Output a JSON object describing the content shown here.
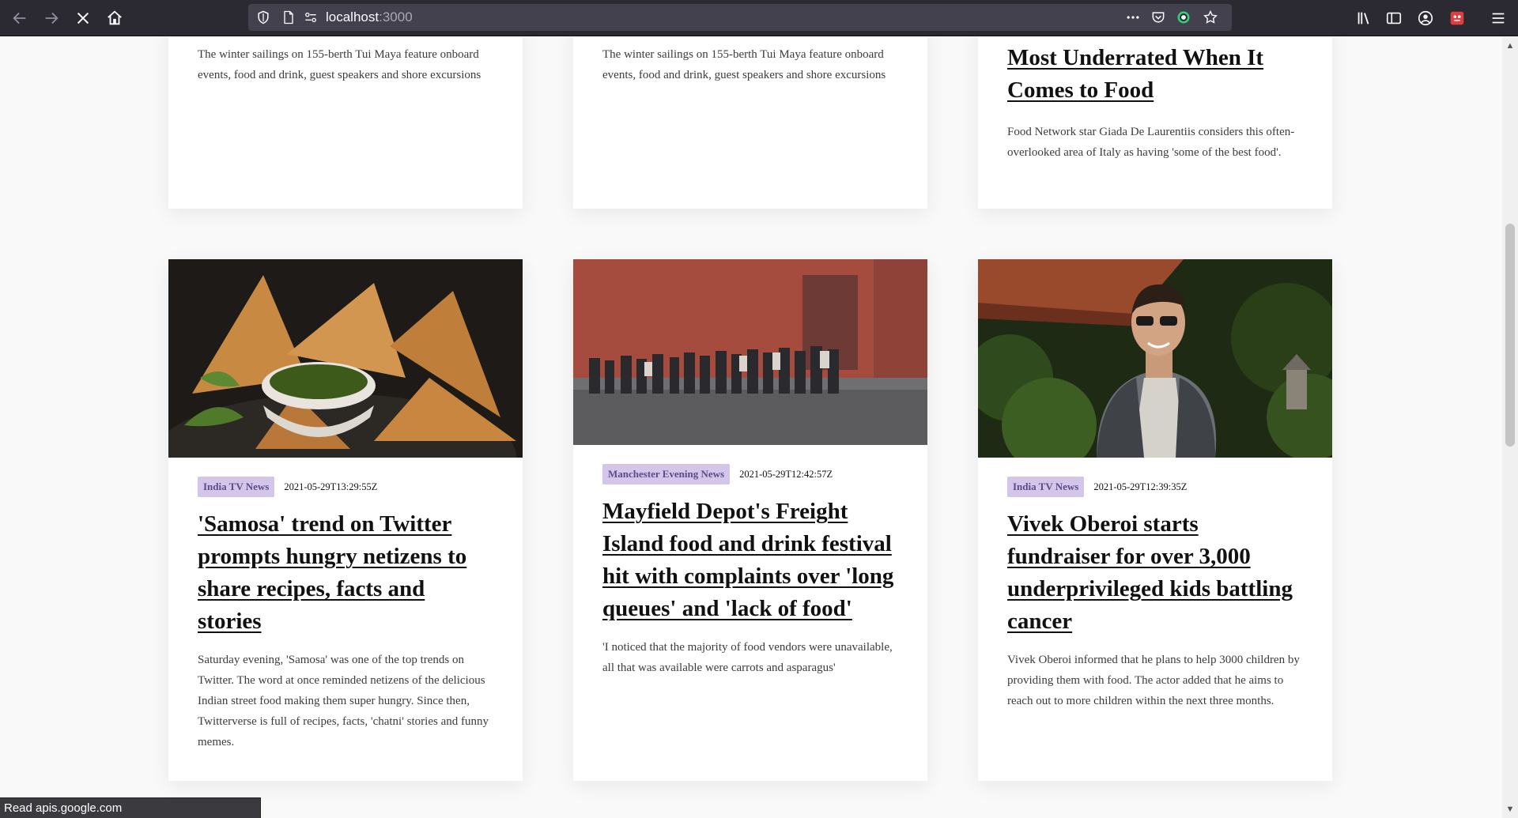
{
  "browser": {
    "url_host": "localhost",
    "url_port": ":3000",
    "status_text": "Read apis.google.com"
  },
  "top_cards": [
    {
      "desc": "The winter sailings on 155-berth Tui Maya feature onboard events, food and drink, guest speakers and shore excursions"
    },
    {
      "desc": "The winter sailings on 155-berth Tui Maya feature onboard events, food and drink, guest speakers and shore excursions"
    },
    {
      "title": "Most Underrated When It Comes to Food",
      "desc": "Food Network star Giada De Laurentiis considers this often-overlooked area of Italy as having 'some of the best food'."
    }
  ],
  "cards": [
    {
      "source": "India TV News",
      "date": "2021-05-29T13:29:55Z",
      "title": "'Samosa' trend on Twitter prompts hungry netizens to share recipes, facts and stories",
      "desc": "Saturday evening, 'Samosa' was one of the top trends on Twitter. The word at once reminded netizens of the delicious Indian street food making them super hungry. Since then, Twitterverse is full of recipes, facts, 'chatni' stories and funny memes."
    },
    {
      "source": "Manchester Evening News",
      "date": "2021-05-29T12:42:57Z",
      "title": "Mayfield Depot's Freight Island food and drink festival hit with complaints over 'long queues' and 'lack of food'",
      "desc": "'I noticed that the majority of food vendors were unavailable, all that was available were carrots and asparagus'"
    },
    {
      "source": "India TV News",
      "date": "2021-05-29T12:39:35Z",
      "title": "Vivek Oberoi starts fundraiser for over 3,000 underprivileged kids battling cancer",
      "desc": "Vivek Oberoi informed that he plans to help 3000 children by providing them with food. The actor added that he aims to reach out to more children within the next three months."
    }
  ],
  "colors": {
    "badge_bg": "#d3c6e8",
    "badge_text": "#5e4a8a",
    "toolbar_bg": "#2b2a33"
  }
}
